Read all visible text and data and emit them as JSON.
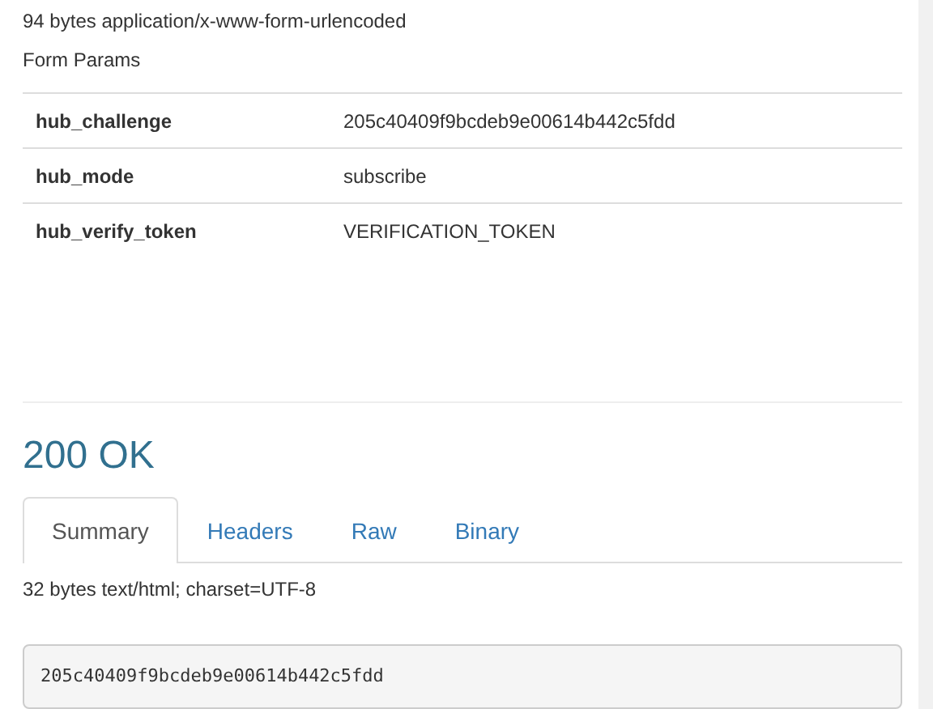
{
  "request": {
    "summary": "94 bytes application/x-www-form-urlencoded",
    "section_title": "Form Params",
    "params": [
      {
        "name": "hub_challenge",
        "value": "205c40409f9bcdeb9e00614b442c5fdd"
      },
      {
        "name": "hub_mode",
        "value": "subscribe"
      },
      {
        "name": "hub_verify_token",
        "value": "VERIFICATION_TOKEN"
      }
    ]
  },
  "response": {
    "status": "200 OK",
    "tabs": [
      {
        "label": "Summary",
        "selected": true
      },
      {
        "label": "Headers",
        "selected": false
      },
      {
        "label": "Raw",
        "selected": false
      },
      {
        "label": "Binary",
        "selected": false
      }
    ],
    "summary": "32 bytes text/html; charset=UTF-8",
    "body": "205c40409f9bcdeb9e00614b442c5fdd"
  }
}
